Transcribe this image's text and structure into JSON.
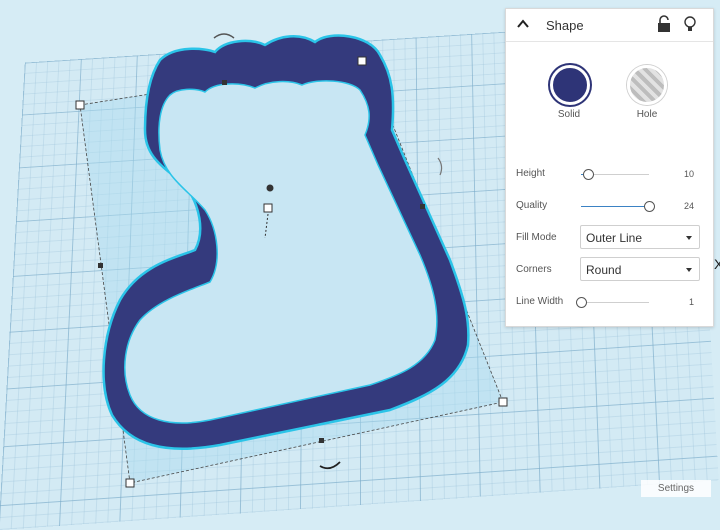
{
  "panel": {
    "title": "Shape",
    "solid_label": "Solid",
    "hole_label": "Hole",
    "rows": {
      "height": {
        "label": "Height",
        "value": "10",
        "fraction": 0.1
      },
      "quality": {
        "label": "Quality",
        "value": "24",
        "fraction": 1.0
      },
      "line_width": {
        "label": "Line Width",
        "value": "1",
        "fraction": 0.0
      }
    },
    "fill_mode": {
      "label": "Fill Mode",
      "selected": "Outer Line"
    },
    "corners": {
      "label": "Corners",
      "selected": "Round"
    }
  },
  "settings_label": "Settings",
  "edge_glyph": "X",
  "colors": {
    "solid": "#2e3477",
    "outline": "#2bc4e8",
    "accent": "#3b82c4"
  }
}
